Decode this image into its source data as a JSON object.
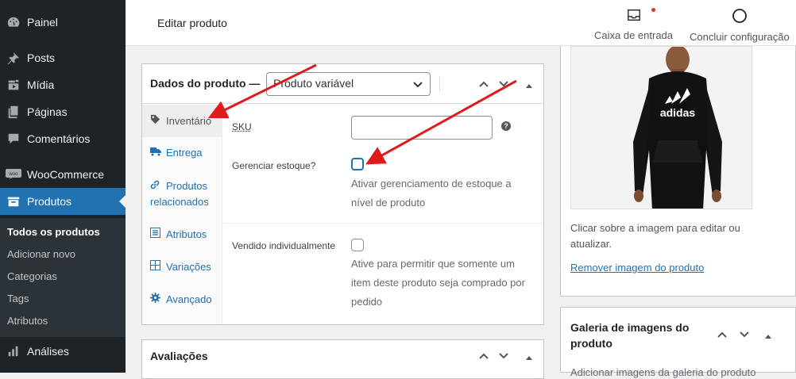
{
  "sidebar": {
    "items": [
      {
        "label": "Painel",
        "icon": "dashboard-icon"
      },
      {
        "label": "Posts",
        "icon": "pin-icon"
      },
      {
        "label": "Mídia",
        "icon": "media-icon"
      },
      {
        "label": "Páginas",
        "icon": "pages-icon"
      },
      {
        "label": "Comentários",
        "icon": "comments-icon"
      },
      {
        "label": "WooCommerce",
        "icon": "woo-icon"
      },
      {
        "label": "Produtos",
        "icon": "products-icon"
      },
      {
        "label": "Análises",
        "icon": "analytics-icon"
      }
    ],
    "submenu": [
      "Todos os produtos",
      "Adicionar novo",
      "Categorias",
      "Tags",
      "Atributos"
    ]
  },
  "header": {
    "title": "Editar produto",
    "inbox_label": "Caixa de entrada",
    "setup_label": "Concluir configuração"
  },
  "product_data": {
    "title": "Dados do produto —",
    "type_selected": "Produto variável",
    "tabs": [
      {
        "label": "Inventário",
        "icon": "tag-icon"
      },
      {
        "label": "Entrega",
        "icon": "truck-icon"
      },
      {
        "label": "Produtos relacionados",
        "icon": "link-icon"
      },
      {
        "label": "Atributos",
        "icon": "list-icon"
      },
      {
        "label": "Variações",
        "icon": "grid-icon"
      },
      {
        "label": "Avançado",
        "icon": "gear-icon"
      }
    ],
    "sku_label": "SKU",
    "sku_value": "",
    "manage_stock_label": "Gerenciar estoque?",
    "manage_stock_desc": "Ativar gerenciamento de estoque a nível de produto",
    "sold_individually_label": "Vendido individualmente",
    "sold_individually_desc": "Ative para permitir que somente um item deste produto seja comprado por pedido"
  },
  "reviews": {
    "title": "Avaliações"
  },
  "product_image": {
    "hint": "Clicar sobre a imagem para editar ou atualizar.",
    "remove_link": "Remover imagem do produto",
    "brand_text": "adidas"
  },
  "gallery": {
    "title": "Galeria de imagens do produto",
    "desc": "Adicionar imagens da galeria do produto"
  },
  "colors": {
    "accent": "#2271b1",
    "sidebar": "#1d2327",
    "annotation_arrow": "#e0191b"
  }
}
